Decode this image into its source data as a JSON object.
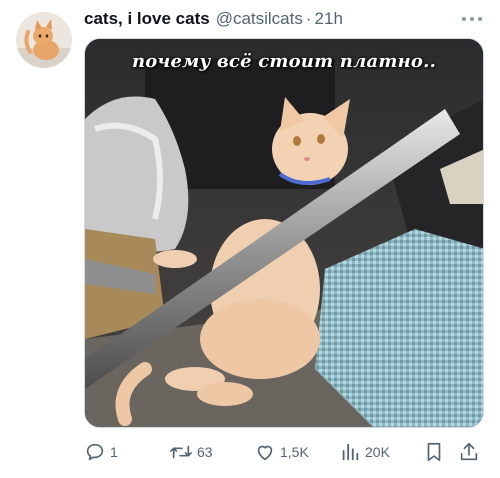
{
  "tweet": {
    "display_name": "cats, i love cats",
    "handle": "@catsilcats",
    "separator": "·",
    "time": "21h",
    "media_caption": "почему всё стоит платно.."
  },
  "actions": {
    "reply_count": "1",
    "retweet_count": "63",
    "like_count": "1,5K",
    "views_count": "20K"
  },
  "icons": {
    "reply": "reply-icon",
    "retweet": "retweet-icon",
    "like": "heart-icon",
    "views": "views-icon",
    "bookmark": "bookmark-icon",
    "share": "share-icon",
    "more": "more-icon"
  },
  "colors": {
    "text": "#0f1419",
    "secondary": "#536471",
    "border": "#cfd9de"
  }
}
